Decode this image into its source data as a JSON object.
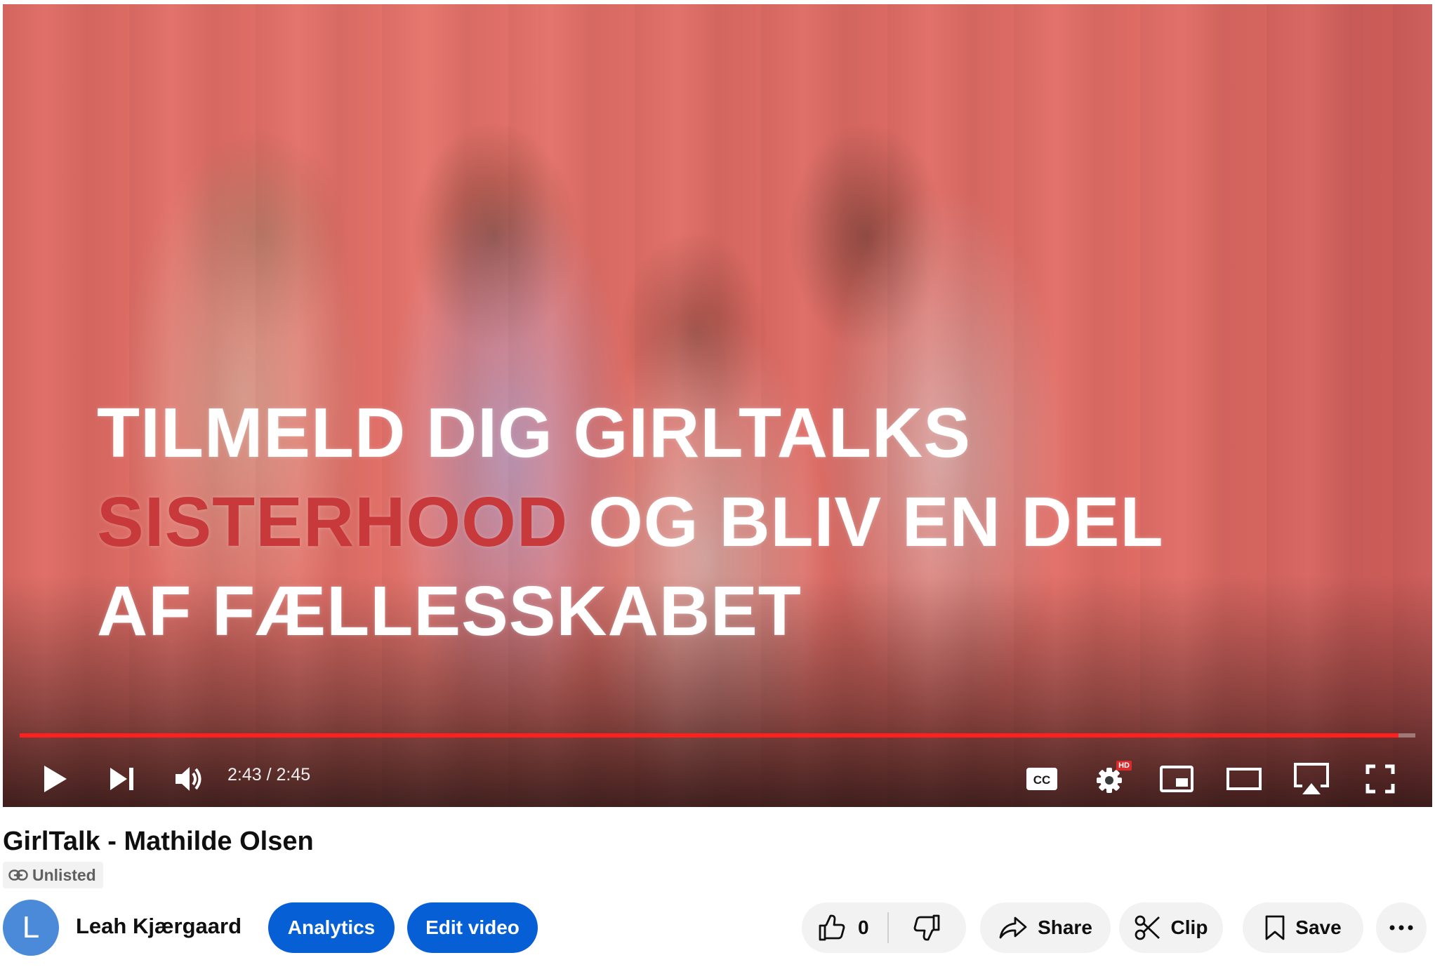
{
  "video": {
    "overlay_line1": "TILMELD DIG GIRLTALKS",
    "overlay_line2_highlight": "SISTERHOOD",
    "overlay_line2_rest": " OG BLIV EN DEL",
    "overlay_line3": "AF FÆLLESSKABET",
    "overlay_highlight_color": "#c8393c",
    "progress_fraction": 0.988
  },
  "player_controls": {
    "time_current": "2:43",
    "time_separator": " / ",
    "time_total": "2:45",
    "hd_badge": "HD",
    "icons": [
      "play-icon",
      "next-icon",
      "volume-icon",
      "captions-icon",
      "settings-icon",
      "miniplayer-icon",
      "theater-mode-icon",
      "airplay-icon",
      "fullscreen-icon"
    ]
  },
  "details": {
    "title": "GirlTalk - Mathilde Olsen",
    "visibility": "Unlisted",
    "avatar_letter": "L",
    "avatar_color": "#4a8ad8",
    "channel_name": "Leah Kjærgaard"
  },
  "actions": {
    "analytics_label": "Analytics",
    "edit_label": "Edit video",
    "like_count": "0",
    "share_label": "Share",
    "clip_label": "Clip",
    "save_label": "Save",
    "accent_color": "#065fd4"
  }
}
